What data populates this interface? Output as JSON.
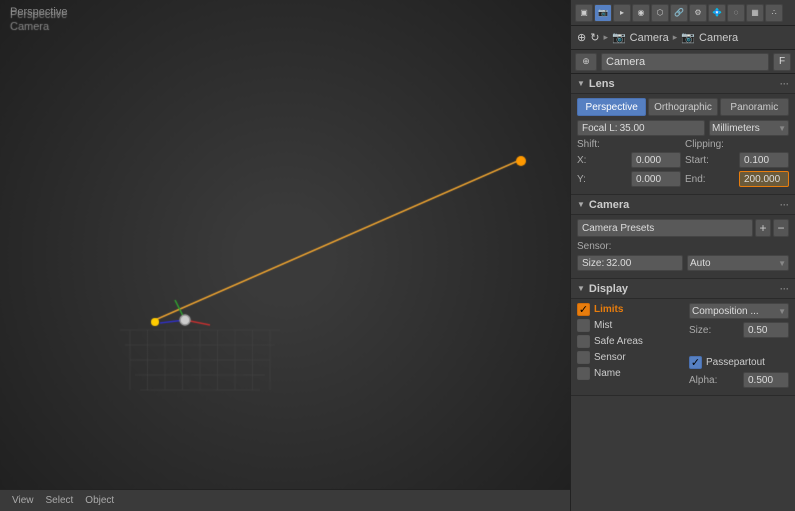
{
  "viewport": {
    "perspective_label": "Perspective",
    "camera_label": "Camera"
  },
  "panel": {
    "toolbar": {
      "icons": [
        "⊞",
        "☰",
        "⚙",
        "📷",
        "🔧",
        "💎",
        "🔗",
        "⬡",
        "⬢",
        "★",
        "✦"
      ]
    },
    "breadcrumb": {
      "icon1": "⊕",
      "icon2": "↻",
      "sep1": "▸",
      "camera_icon": "📷",
      "label1": "Camera",
      "sep2": "▸",
      "camera_icon2": "📷",
      "label2": "Camera"
    },
    "camera_select": {
      "icon": "⊕",
      "name": "Camera",
      "f_label": "F"
    },
    "lens": {
      "section_title": "Lens",
      "tabs": [
        {
          "label": "Perspective",
          "active": true
        },
        {
          "label": "Orthographic",
          "active": false
        },
        {
          "label": "Panoramic",
          "active": false
        }
      ],
      "focal_label": "Focal L:",
      "focal_value": "35.00",
      "unit_label": "Millimeters",
      "shift_label": "Shift:",
      "x_label": "X:",
      "x_value": "0.000",
      "y_label": "Y:",
      "y_value": "0.000",
      "clipping_label": "Clipping:",
      "start_label": "Start:",
      "start_value": "0.100",
      "end_label": "End:",
      "end_value": "200.000"
    },
    "camera": {
      "section_title": "Camera",
      "presets_label": "Camera Presets",
      "sensor_label": "Sensor:",
      "size_label": "Size:",
      "size_value": "32.00",
      "auto_label": "Auto"
    },
    "display": {
      "section_title": "Display",
      "limits_label": "Limits",
      "limits_checked": true,
      "mist_label": "Mist",
      "mist_checked": false,
      "safe_areas_label": "Safe Areas",
      "safe_areas_checked": false,
      "sensor_label": "Sensor",
      "sensor_checked": false,
      "name_label": "Name",
      "name_checked": false,
      "composition_label": "Composition ...",
      "size_label": "Size:",
      "size_value": "0.50",
      "passepartout_label": "Passepartout",
      "passepartout_checked": true,
      "alpha_label": "Alpha:",
      "alpha_value": "0.500"
    }
  }
}
